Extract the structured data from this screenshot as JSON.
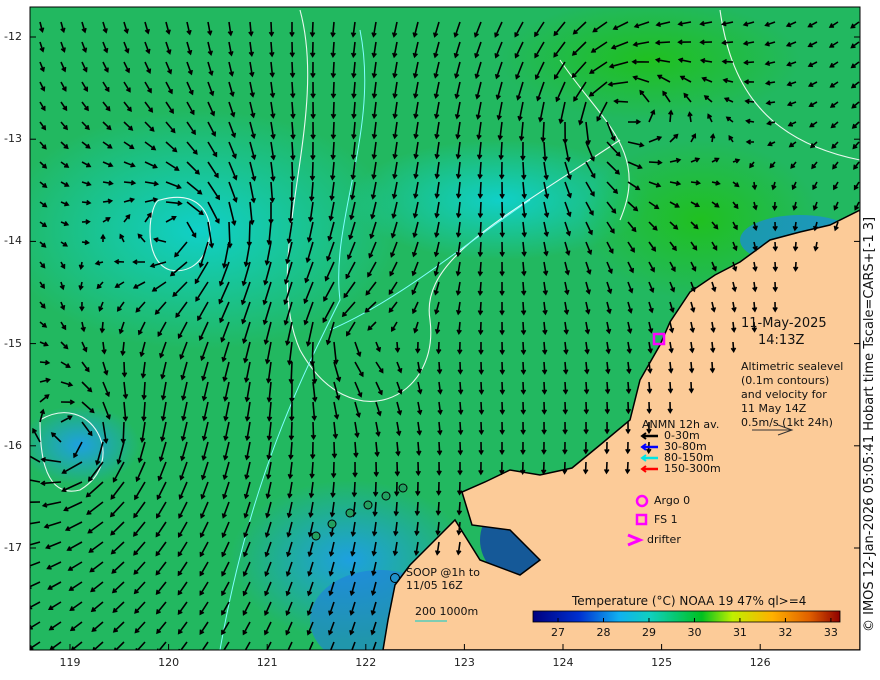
{
  "map": {
    "lon_ticks": [
      "119",
      "120",
      "121",
      "122",
      "123",
      "124",
      "125",
      "126"
    ],
    "lat_ticks": [
      "-12",
      "-13",
      "-14",
      "-15",
      "-16",
      "-17"
    ],
    "date": "11-May-2025",
    "time": "14:13Z",
    "altimetry_note": [
      "Altimetric sealevel",
      "(0.1m contours)",
      "and velocity for",
      "11 May 14Z",
      "0.5m/s (1kt 24h)"
    ],
    "side_caption": "© IMOS 12-Jan-2026 05:05:41 Hobart time Tscale=CARS+[-1 3]"
  },
  "legend": {
    "anmn_title": "ANMN 12h av.",
    "depths": [
      {
        "label": "0-30m",
        "color": "#000000"
      },
      {
        "label": "30-80m",
        "color": "#0000ff"
      },
      {
        "label": "80-150m",
        "color": "#00e5e5"
      },
      {
        "label": "150-300m",
        "color": "#ff0000"
      }
    ],
    "argo": "Argo 0",
    "fs": "FS 1",
    "drifter": "drifter",
    "soop": [
      "SOOP @1h to",
      "11/05 16Z"
    ],
    "isobath": "200  1000m",
    "marker_color": "#ff00ff"
  },
  "colorbar": {
    "title": "Temperature (°C) NOAA 19 47% ql>=4",
    "ticks": [
      "27",
      "28",
      "29",
      "30",
      "31",
      "32",
      "33"
    ],
    "range": [
      26.45,
      33.2
    ]
  }
}
